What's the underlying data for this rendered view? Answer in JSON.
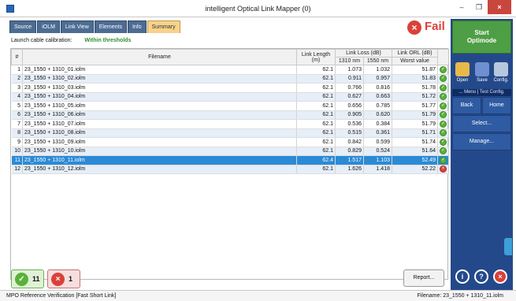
{
  "window": {
    "title": "intelligent Optical Link Mapper (0)",
    "min": "–",
    "max": "❐",
    "close": "×"
  },
  "tabs": [
    "Source",
    "iOLM",
    "Link View",
    "Elements",
    "Info",
    "Summary"
  ],
  "active_tab": "Summary",
  "result": {
    "icon": "fail-x",
    "text": "Fail",
    "color": "#d9413a"
  },
  "calibration": {
    "label": "Launch cable calibration:",
    "value": "Within thresholds"
  },
  "table": {
    "headers": {
      "idx": "#",
      "filename": "Filename",
      "link_length": "Link Length (m)",
      "link_loss": "Link Loss (dB)",
      "loss_1310": "1310 nm",
      "loss_1550": "1550 nm",
      "link_orl": "Link ORL (dB)",
      "worst_value": "Worst value"
    },
    "rows": [
      {
        "n": "1",
        "file": "23_1550 + 1310_01.iolm",
        "len": "62.1",
        "l1310": "1.073",
        "l1550": "1.032",
        "orl": "51.87",
        "status": "pass"
      },
      {
        "n": "2",
        "file": "23_1550 + 1310_02.iolm",
        "len": "62.1",
        "l1310": "0.911",
        "l1550": "0.957",
        "orl": "51.83",
        "status": "pass"
      },
      {
        "n": "3",
        "file": "23_1550 + 1310_03.iolm",
        "len": "62.1",
        "l1310": "0.766",
        "l1550": "0.816",
        "orl": "51.78",
        "status": "pass"
      },
      {
        "n": "4",
        "file": "23_1550 + 1310_04.iolm",
        "len": "62.1",
        "l1310": "0.627",
        "l1550": "0.663",
        "orl": "51.72",
        "status": "pass"
      },
      {
        "n": "5",
        "file": "23_1550 + 1310_05.iolm",
        "len": "62.1",
        "l1310": "0.656",
        "l1550": "0.785",
        "orl": "51.77",
        "status": "pass"
      },
      {
        "n": "6",
        "file": "23_1550 + 1310_06.iolm",
        "len": "62.1",
        "l1310": "0.905",
        "l1550": "0.620",
        "orl": "51.79",
        "status": "pass"
      },
      {
        "n": "7",
        "file": "23_1550 + 1310_07.iolm",
        "len": "62.1",
        "l1310": "0.536",
        "l1550": "0.384",
        "orl": "51.79",
        "status": "pass"
      },
      {
        "n": "8",
        "file": "23_1550 + 1310_08.iolm",
        "len": "62.1",
        "l1310": "0.515",
        "l1550": "0.361",
        "orl": "51.71",
        "status": "pass"
      },
      {
        "n": "9",
        "file": "23_1550 + 1310_09.iolm",
        "len": "62.1",
        "l1310": "0.842",
        "l1550": "0.599",
        "orl": "51.74",
        "status": "pass"
      },
      {
        "n": "10",
        "file": "23_1550 + 1310_10.iolm",
        "len": "62.1",
        "l1310": "0.829",
        "l1550": "0.524",
        "orl": "51.64",
        "status": "pass"
      },
      {
        "n": "11",
        "file": "23_1550 + 1310_11.iolm",
        "len": "62.4",
        "l1310": "1.517",
        "l1550": "1.103",
        "orl": "52.49",
        "status": "pass"
      },
      {
        "n": "12",
        "file": "23_1550 + 1310_12.iolm",
        "len": "62.1",
        "l1310": "1.626",
        "l1550": "1.418",
        "orl": "52.22",
        "status": "fail"
      }
    ],
    "selected_row": "11"
  },
  "summary": {
    "pass_count": "11",
    "fail_count": "1"
  },
  "report_button": "Report...",
  "statusbar": {
    "left": "MPO Reference Verification [Fast Short Link]",
    "right": "Filename: 23_1550 + 1310_11.iolm"
  },
  "sidebar": {
    "start_line1": "Start",
    "start_line2": "Optimode",
    "open": "Open",
    "save": "Save",
    "config": "Config.",
    "menu_strip": "... Menu | Test Config.",
    "back": "Back",
    "home": "Home",
    "select": "Select...",
    "manage": "Manage...",
    "info": "i",
    "help": "?",
    "exit": "×"
  }
}
